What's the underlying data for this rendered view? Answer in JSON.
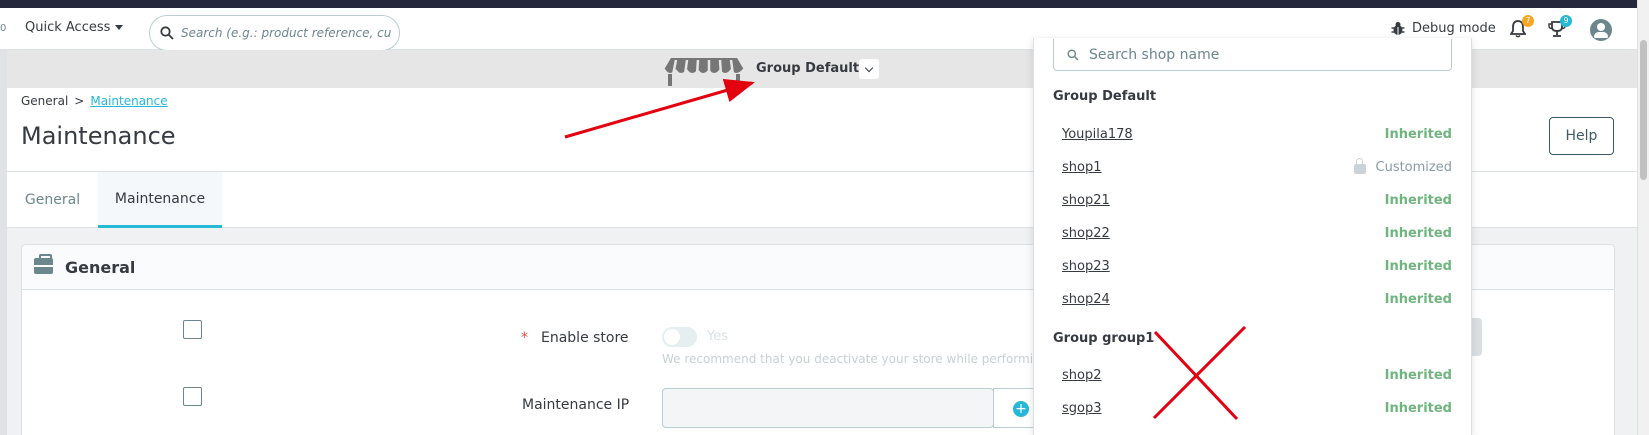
{
  "left_edge": {
    "marker": "0"
  },
  "topbar": {
    "quick_access_label": "Quick Access",
    "search_placeholder": "Search (e.g.: product reference, custon",
    "debug_label": "Debug mode",
    "notifications_count": "7",
    "orders_count": "9"
  },
  "shop_header": {
    "current_shop": "Group Default"
  },
  "breadcrumb": {
    "parent": "General",
    "separator": ">",
    "current": "Maintenance"
  },
  "page": {
    "title": "Maintenance",
    "help_label": "Help"
  },
  "tabs": [
    {
      "label": "General",
      "active": false
    },
    {
      "label": "Maintenance",
      "active": true
    }
  ],
  "card": {
    "title": "General",
    "required_mark": "*",
    "enable_store_label": "Enable store",
    "enable_store_value": "Yes",
    "enable_store_help": "We recommend that you deactivate your store while performing m",
    "maintenance_ip_label": "Maintenance IP",
    "maintenance_ip_value": ""
  },
  "dropdown": {
    "search_placeholder": "Search shop name",
    "groups": [
      {
        "name": "Group Default",
        "shops": [
          {
            "name": "Youpila178",
            "status": "Inherited"
          },
          {
            "name": "shop1",
            "status": "Customized"
          },
          {
            "name": "shop21",
            "status": "Inherited"
          },
          {
            "name": "shop22",
            "status": "Inherited"
          },
          {
            "name": "shop23",
            "status": "Inherited"
          },
          {
            "name": "shop24",
            "status": "Inherited"
          }
        ]
      },
      {
        "name": "Group group1",
        "shops": [
          {
            "name": "shop2",
            "status": "Inherited"
          },
          {
            "name": "sgop3",
            "status": "Inherited"
          }
        ]
      }
    ]
  },
  "colors": {
    "accent": "#25b9d7",
    "inherited": "#70b580",
    "customized": "#8a9ba2",
    "annotation_red": "#e3000f",
    "badge_notifications": "#f5a623",
    "badge_orders": "#25b9d7"
  },
  "icons": [
    "search-icon",
    "bug-icon",
    "bell-icon",
    "trophy-icon",
    "user-icon",
    "shop-awning-icon",
    "chevron-down-icon",
    "briefcase-icon",
    "lock-icon",
    "plus-circle-icon"
  ]
}
